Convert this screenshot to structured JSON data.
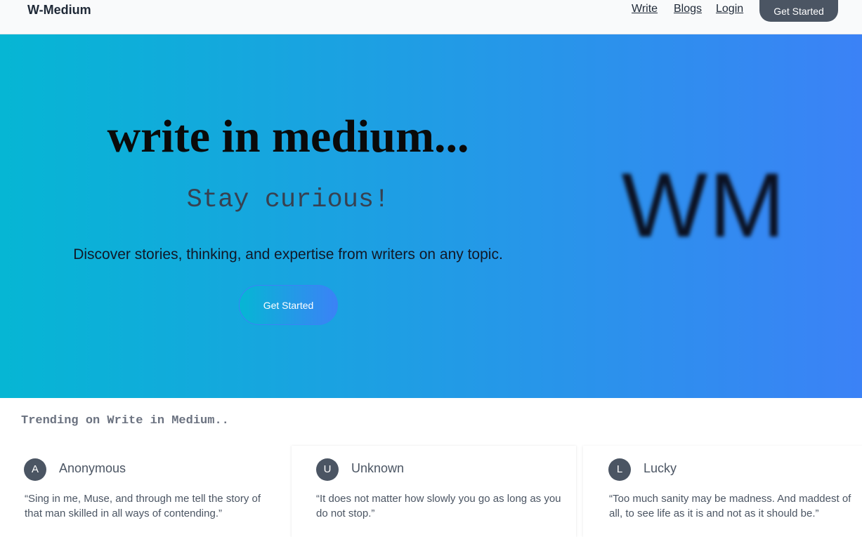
{
  "nav": {
    "brand": "W-Medium",
    "links": [
      "Write",
      "Blogs",
      "Login"
    ],
    "cta": "Get Started"
  },
  "hero": {
    "title": "write in medium...",
    "subtitle": "Stay curious!",
    "tagline": "Discover stories, thinking, and expertise from writers on any topic.",
    "cta": "Get Started",
    "logo": "WM"
  },
  "trending": {
    "heading": "Trending on Write in Medium..",
    "cards": [
      {
        "initial": "A",
        "author": "Anonymous",
        "quote": "“Sing in me, Muse, and through me tell the story of that man skilled in all ways of contending.”"
      },
      {
        "initial": "U",
        "author": "Unknown",
        "quote": "“It does not matter how slowly you go as long as you do not stop.”"
      },
      {
        "initial": "L",
        "author": "Lucky",
        "quote": "“Too much sanity may be madness. And maddest of all, to see life as it is and not as it should be.”"
      }
    ]
  },
  "colors": {
    "gradient_start": "#06b6d4",
    "gradient_end": "#3b82f6",
    "button_dark": "#4b5563"
  }
}
